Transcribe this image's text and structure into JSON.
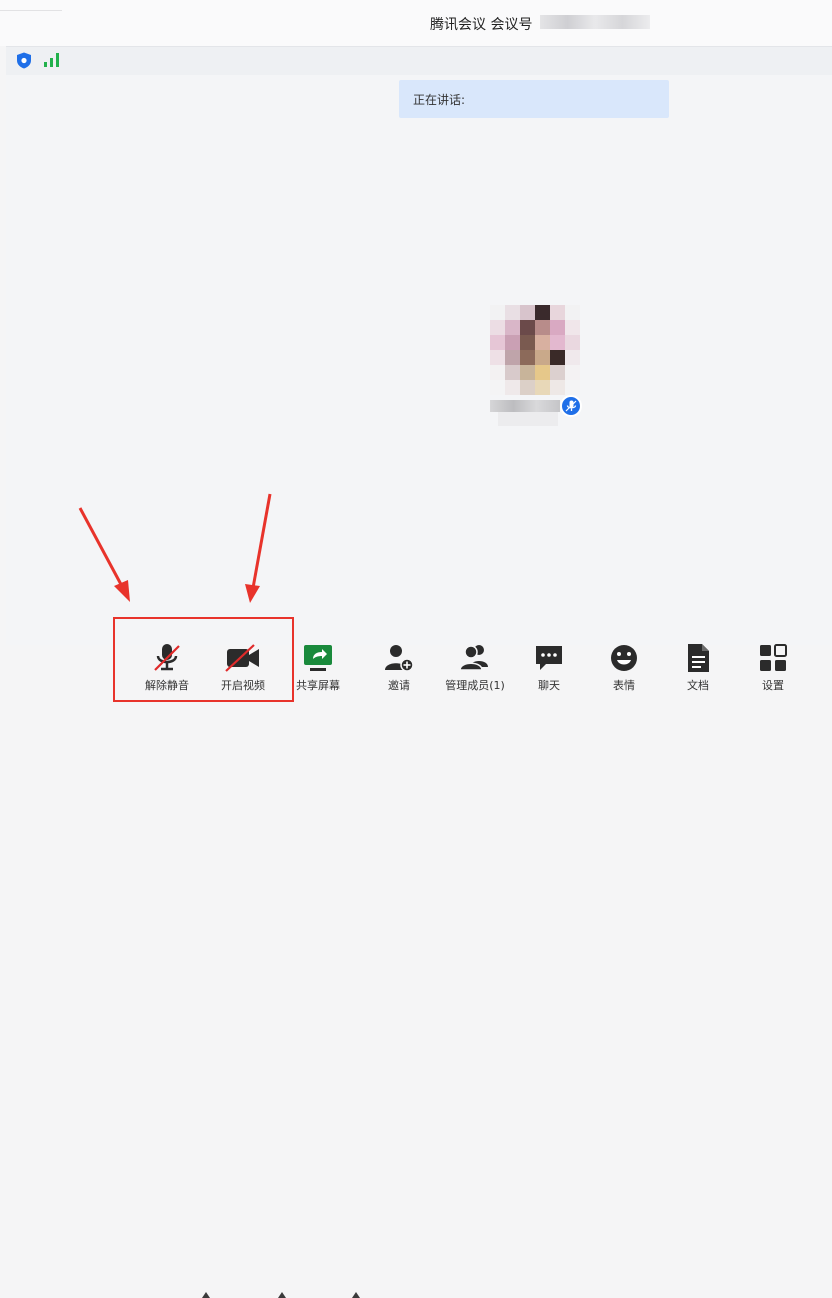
{
  "window": {
    "title": "腾讯会议 会议号"
  },
  "banner": {
    "speaking_label": "正在讲话:"
  },
  "colors": {
    "accent": "#1f6fe8",
    "signal": "#22b14c",
    "annotation": "#e8332b",
    "banner_bg": "#d9e7fb"
  },
  "icons": {
    "status": [
      "shield-icon",
      "signal-icon"
    ],
    "participant_badge": "microphone-icon"
  },
  "toolbar": {
    "unmute": "解除静音",
    "start_video": "开启视频",
    "share_screen": "共享屏幕",
    "invite": "邀请",
    "manage_members": "管理成员(1)",
    "chat": "聊天",
    "reactions": "表情",
    "documents": "文档",
    "settings": "设置"
  }
}
